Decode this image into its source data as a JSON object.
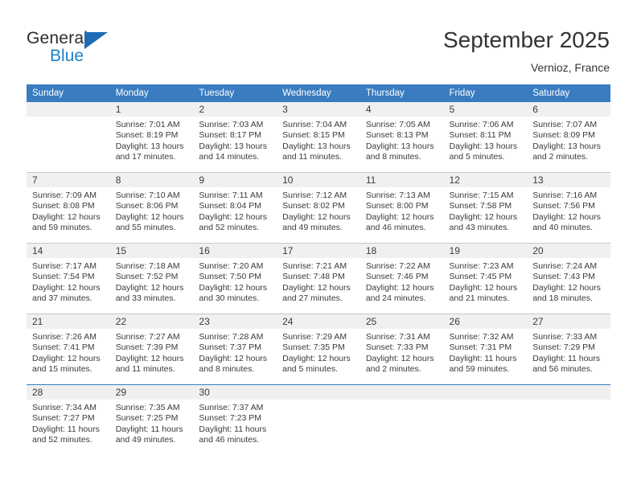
{
  "brand": {
    "name_dark": "General",
    "name_blue": "Blue",
    "accent_blue": "#1f7fc4",
    "header_blue": "#3a7cc0"
  },
  "header": {
    "title": "September 2025",
    "location": "Vernioz, France"
  },
  "calendar": {
    "weekday_headers": [
      "Sunday",
      "Monday",
      "Tuesday",
      "Wednesday",
      "Thursday",
      "Friday",
      "Saturday"
    ],
    "labels": {
      "sunrise": "Sunrise:",
      "sunset": "Sunset:",
      "daylight": "Daylight:"
    },
    "weeks": [
      [
        {
          "day": "",
          "sunrise": "",
          "sunset": "",
          "daylight_a": "",
          "daylight_b": ""
        },
        {
          "day": "1",
          "sunrise": "Sunrise: 7:01 AM",
          "sunset": "Sunset: 8:19 PM",
          "daylight_a": "Daylight: 13 hours",
          "daylight_b": "and 17 minutes."
        },
        {
          "day": "2",
          "sunrise": "Sunrise: 7:03 AM",
          "sunset": "Sunset: 8:17 PM",
          "daylight_a": "Daylight: 13 hours",
          "daylight_b": "and 14 minutes."
        },
        {
          "day": "3",
          "sunrise": "Sunrise: 7:04 AM",
          "sunset": "Sunset: 8:15 PM",
          "daylight_a": "Daylight: 13 hours",
          "daylight_b": "and 11 minutes."
        },
        {
          "day": "4",
          "sunrise": "Sunrise: 7:05 AM",
          "sunset": "Sunset: 8:13 PM",
          "daylight_a": "Daylight: 13 hours",
          "daylight_b": "and 8 minutes."
        },
        {
          "day": "5",
          "sunrise": "Sunrise: 7:06 AM",
          "sunset": "Sunset: 8:11 PM",
          "daylight_a": "Daylight: 13 hours",
          "daylight_b": "and 5 minutes."
        },
        {
          "day": "6",
          "sunrise": "Sunrise: 7:07 AM",
          "sunset": "Sunset: 8:09 PM",
          "daylight_a": "Daylight: 13 hours",
          "daylight_b": "and 2 minutes."
        }
      ],
      [
        {
          "day": "7",
          "sunrise": "Sunrise: 7:09 AM",
          "sunset": "Sunset: 8:08 PM",
          "daylight_a": "Daylight: 12 hours",
          "daylight_b": "and 59 minutes."
        },
        {
          "day": "8",
          "sunrise": "Sunrise: 7:10 AM",
          "sunset": "Sunset: 8:06 PM",
          "daylight_a": "Daylight: 12 hours",
          "daylight_b": "and 55 minutes."
        },
        {
          "day": "9",
          "sunrise": "Sunrise: 7:11 AM",
          "sunset": "Sunset: 8:04 PM",
          "daylight_a": "Daylight: 12 hours",
          "daylight_b": "and 52 minutes."
        },
        {
          "day": "10",
          "sunrise": "Sunrise: 7:12 AM",
          "sunset": "Sunset: 8:02 PM",
          "daylight_a": "Daylight: 12 hours",
          "daylight_b": "and 49 minutes."
        },
        {
          "day": "11",
          "sunrise": "Sunrise: 7:13 AM",
          "sunset": "Sunset: 8:00 PM",
          "daylight_a": "Daylight: 12 hours",
          "daylight_b": "and 46 minutes."
        },
        {
          "day": "12",
          "sunrise": "Sunrise: 7:15 AM",
          "sunset": "Sunset: 7:58 PM",
          "daylight_a": "Daylight: 12 hours",
          "daylight_b": "and 43 minutes."
        },
        {
          "day": "13",
          "sunrise": "Sunrise: 7:16 AM",
          "sunset": "Sunset: 7:56 PM",
          "daylight_a": "Daylight: 12 hours",
          "daylight_b": "and 40 minutes."
        }
      ],
      [
        {
          "day": "14",
          "sunrise": "Sunrise: 7:17 AM",
          "sunset": "Sunset: 7:54 PM",
          "daylight_a": "Daylight: 12 hours",
          "daylight_b": "and 37 minutes."
        },
        {
          "day": "15",
          "sunrise": "Sunrise: 7:18 AM",
          "sunset": "Sunset: 7:52 PM",
          "daylight_a": "Daylight: 12 hours",
          "daylight_b": "and 33 minutes."
        },
        {
          "day": "16",
          "sunrise": "Sunrise: 7:20 AM",
          "sunset": "Sunset: 7:50 PM",
          "daylight_a": "Daylight: 12 hours",
          "daylight_b": "and 30 minutes."
        },
        {
          "day": "17",
          "sunrise": "Sunrise: 7:21 AM",
          "sunset": "Sunset: 7:48 PM",
          "daylight_a": "Daylight: 12 hours",
          "daylight_b": "and 27 minutes."
        },
        {
          "day": "18",
          "sunrise": "Sunrise: 7:22 AM",
          "sunset": "Sunset: 7:46 PM",
          "daylight_a": "Daylight: 12 hours",
          "daylight_b": "and 24 minutes."
        },
        {
          "day": "19",
          "sunrise": "Sunrise: 7:23 AM",
          "sunset": "Sunset: 7:45 PM",
          "daylight_a": "Daylight: 12 hours",
          "daylight_b": "and 21 minutes."
        },
        {
          "day": "20",
          "sunrise": "Sunrise: 7:24 AM",
          "sunset": "Sunset: 7:43 PM",
          "daylight_a": "Daylight: 12 hours",
          "daylight_b": "and 18 minutes."
        }
      ],
      [
        {
          "day": "21",
          "sunrise": "Sunrise: 7:26 AM",
          "sunset": "Sunset: 7:41 PM",
          "daylight_a": "Daylight: 12 hours",
          "daylight_b": "and 15 minutes."
        },
        {
          "day": "22",
          "sunrise": "Sunrise: 7:27 AM",
          "sunset": "Sunset: 7:39 PM",
          "daylight_a": "Daylight: 12 hours",
          "daylight_b": "and 11 minutes."
        },
        {
          "day": "23",
          "sunrise": "Sunrise: 7:28 AM",
          "sunset": "Sunset: 7:37 PM",
          "daylight_a": "Daylight: 12 hours",
          "daylight_b": "and 8 minutes."
        },
        {
          "day": "24",
          "sunrise": "Sunrise: 7:29 AM",
          "sunset": "Sunset: 7:35 PM",
          "daylight_a": "Daylight: 12 hours",
          "daylight_b": "and 5 minutes."
        },
        {
          "day": "25",
          "sunrise": "Sunrise: 7:31 AM",
          "sunset": "Sunset: 7:33 PM",
          "daylight_a": "Daylight: 12 hours",
          "daylight_b": "and 2 minutes."
        },
        {
          "day": "26",
          "sunrise": "Sunrise: 7:32 AM",
          "sunset": "Sunset: 7:31 PM",
          "daylight_a": "Daylight: 11 hours",
          "daylight_b": "and 59 minutes."
        },
        {
          "day": "27",
          "sunrise": "Sunrise: 7:33 AM",
          "sunset": "Sunset: 7:29 PM",
          "daylight_a": "Daylight: 11 hours",
          "daylight_b": "and 56 minutes."
        }
      ],
      [
        {
          "day": "28",
          "sunrise": "Sunrise: 7:34 AM",
          "sunset": "Sunset: 7:27 PM",
          "daylight_a": "Daylight: 11 hours",
          "daylight_b": "and 52 minutes."
        },
        {
          "day": "29",
          "sunrise": "Sunrise: 7:35 AM",
          "sunset": "Sunset: 7:25 PM",
          "daylight_a": "Daylight: 11 hours",
          "daylight_b": "and 49 minutes."
        },
        {
          "day": "30",
          "sunrise": "Sunrise: 7:37 AM",
          "sunset": "Sunset: 7:23 PM",
          "daylight_a": "Daylight: 11 hours",
          "daylight_b": "and 46 minutes."
        },
        {
          "day": "",
          "sunrise": "",
          "sunset": "",
          "daylight_a": "",
          "daylight_b": ""
        },
        {
          "day": "",
          "sunrise": "",
          "sunset": "",
          "daylight_a": "",
          "daylight_b": ""
        },
        {
          "day": "",
          "sunrise": "",
          "sunset": "",
          "daylight_a": "",
          "daylight_b": ""
        },
        {
          "day": "",
          "sunrise": "",
          "sunset": "",
          "daylight_a": "",
          "daylight_b": ""
        }
      ]
    ]
  }
}
